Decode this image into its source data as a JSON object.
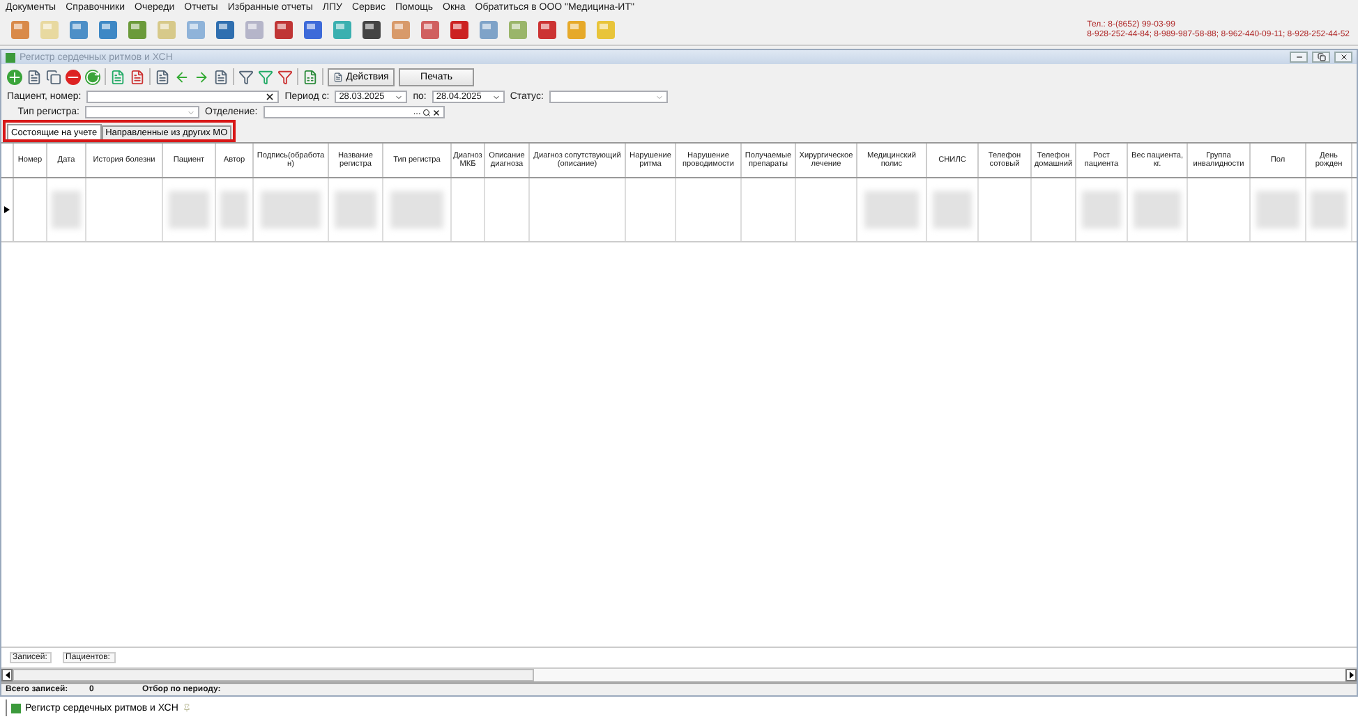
{
  "menu": [
    "Документы",
    "Справочники",
    "Очереди",
    "Отчеты",
    "Избранные отчеты",
    "ЛПУ",
    "Сервис",
    "Помощь",
    "Окна",
    "Обратиться в ООО \"Медицина-ИТ\""
  ],
  "contacts": [
    "Тел.: 8-(8652) 99-03-99",
    "8-928-252-44-84; 8-989-987-58-88; 8-962-440-09-11; 8-928-252-44-52"
  ],
  "window": {
    "title": "Регистр сердечных ритмов и ХСН"
  },
  "actions": [
    {
      "label": "Действия",
      "kind": "menu"
    },
    {
      "label": "Печать",
      "kind": "plain"
    }
  ],
  "filters": {
    "patient_label": "Пациент, номер:",
    "period_from_label": "Период с:",
    "period_from": "28.03.2025",
    "period_to_label": "по:",
    "period_to": "28.04.2025",
    "status_label": "Статус:",
    "register_type_label": "Тип регистра:",
    "department_label": "Отделение:",
    "ellipsis": "..."
  },
  "tabs": [
    {
      "label": "Состоящие на учете",
      "selected": true
    },
    {
      "label": "Направленные из других МО",
      "selected": false
    }
  ],
  "table": {
    "columns": [
      "Номер",
      "Дата",
      "История болезни",
      "Пациент",
      "Автор",
      "Подпись(обработан)",
      "Название регистра",
      "Тип регистра",
      "Диагноз МКБ",
      "Описание диагноза",
      "Диагноз сопутствующий (описание)",
      "Нарушение ритма",
      "Нарушение проводимости",
      "Получаемые препараты",
      "Хирургическое лечение",
      "Медицинский полис",
      "СНИЛС",
      "Телефон сотовый",
      "Телефон домашний",
      "Рост пациента",
      "Вес пациента, кг.",
      "Группа инвалидности",
      "Пол",
      "День рожден"
    ],
    "rows": [
      {
        "current": true,
        "cells": [
          {
            "redacted": false
          },
          {
            "redacted": true
          },
          {
            "redacted": false
          },
          {
            "redacted": true
          },
          {
            "redacted": true
          },
          {
            "redacted": true
          },
          {
            "redacted": true
          },
          {
            "redacted": true
          },
          {
            "redacted": false
          },
          {
            "redacted": false
          },
          {
            "redacted": false
          },
          {
            "redacted": false
          },
          {
            "redacted": false
          },
          {
            "redacted": false
          },
          {
            "redacted": false
          },
          {
            "redacted": true
          },
          {
            "redacted": true
          },
          {
            "redacted": false
          },
          {
            "redacted": false
          },
          {
            "redacted": true
          },
          {
            "redacted": true
          },
          {
            "redacted": false
          },
          {
            "redacted": true
          },
          {
            "redacted": true
          }
        ]
      }
    ]
  },
  "summary": [
    "Записей:",
    "Пациентов:"
  ],
  "status_bar": {
    "total_label": "Всего записей:",
    "total": "0",
    "period_label": "Отбор по периоду:"
  },
  "taskbar": [
    {
      "label": "Регистр сердечных ритмов и ХСН"
    }
  ]
}
